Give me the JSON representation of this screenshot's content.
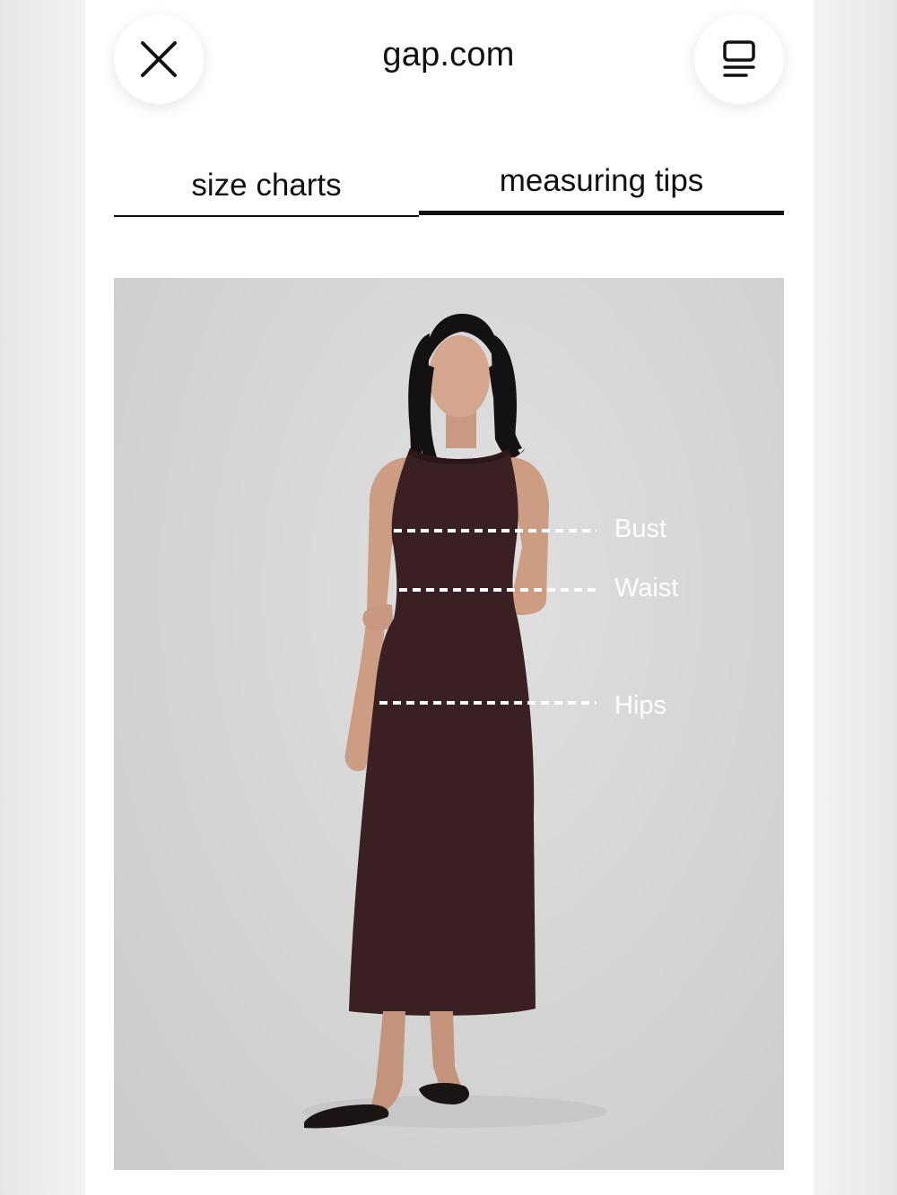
{
  "header": {
    "site_title": "gap.com",
    "close_icon": "close-icon",
    "menu_icon": "menu-icon"
  },
  "tabs": [
    {
      "label": "size charts",
      "active": false
    },
    {
      "label": "measuring tips",
      "active": true
    }
  ],
  "measuring": {
    "labels": {
      "bust": "Bust",
      "waist": "Waist",
      "hips": "Hips"
    }
  },
  "colors": {
    "text": "#111111",
    "dress": "#3a2022",
    "background": "#d8d8d8"
  }
}
